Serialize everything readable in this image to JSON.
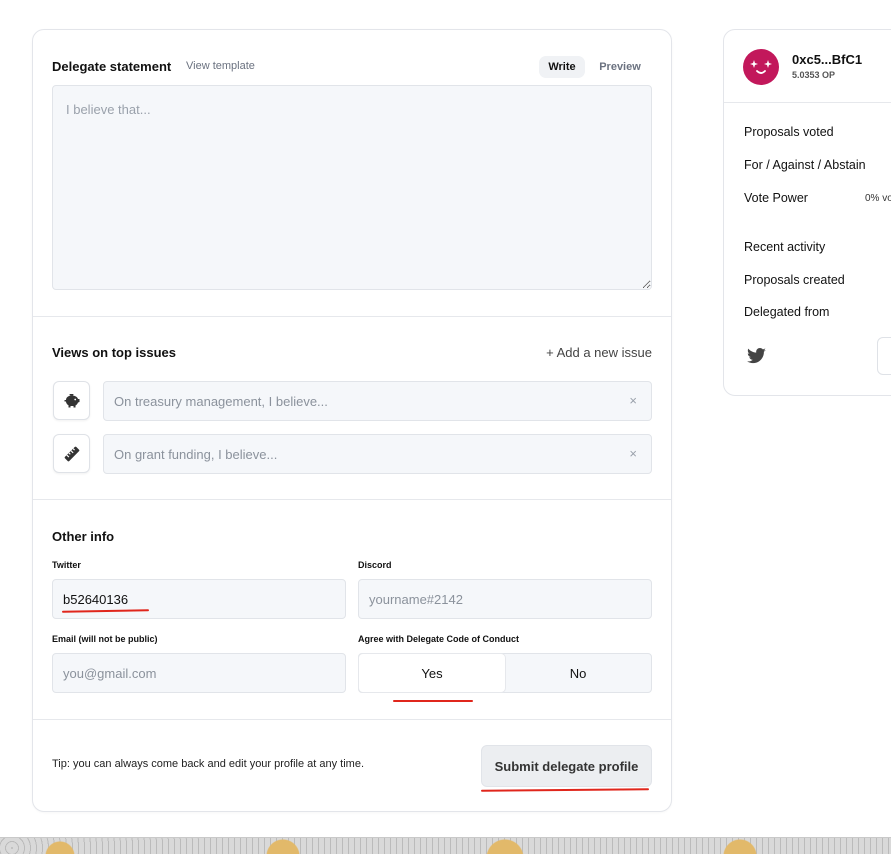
{
  "statement": {
    "title": "Delegate statement",
    "view_template": "View template",
    "tab_write": "Write",
    "tab_preview": "Preview",
    "placeholder": "I believe that..."
  },
  "issues": {
    "title": "Views on top issues",
    "add_label": "+ Add a new issue",
    "items": [
      {
        "icon": "piggy-bank-icon",
        "placeholder": "On treasury management, I believe...",
        "remove": "×"
      },
      {
        "icon": "ruler-icon",
        "placeholder": "On grant funding, I believe...",
        "remove": "×"
      }
    ]
  },
  "other_info": {
    "title": "Other info",
    "twitter_label": "Twitter",
    "twitter_value": "b52640136",
    "discord_label": "Discord",
    "discord_placeholder": "yourname#2142",
    "email_label": "Email (will not be public)",
    "email_placeholder": "you@gmail.com",
    "conduct_label": "Agree with Delegate Code of Conduct",
    "conduct_yes": "Yes",
    "conduct_no": "No",
    "conduct_selected": "Yes"
  },
  "footer": {
    "tip": "Tip: you can always come back and edit your profile at any time.",
    "submit_label": "Submit delegate profile"
  },
  "profile": {
    "address": "0xc5...BfC1",
    "balance": "5.0353 OP",
    "stats": [
      {
        "label": "Proposals voted",
        "value": ""
      },
      {
        "label": "For / Against / Abstain",
        "value": ""
      },
      {
        "label": "Vote Power",
        "value": "0% vo"
      },
      {
        "label": "Recent activity",
        "value": ""
      },
      {
        "label": "Proposals created",
        "value": ""
      },
      {
        "label": "Delegated from",
        "value": ""
      }
    ],
    "social_icon": "twitter-icon"
  },
  "colors": {
    "accent_red": "#e0261c",
    "avatar_bg": "#c2185b",
    "input_bg": "#f5f7fa",
    "border": "#e1e4e9"
  }
}
